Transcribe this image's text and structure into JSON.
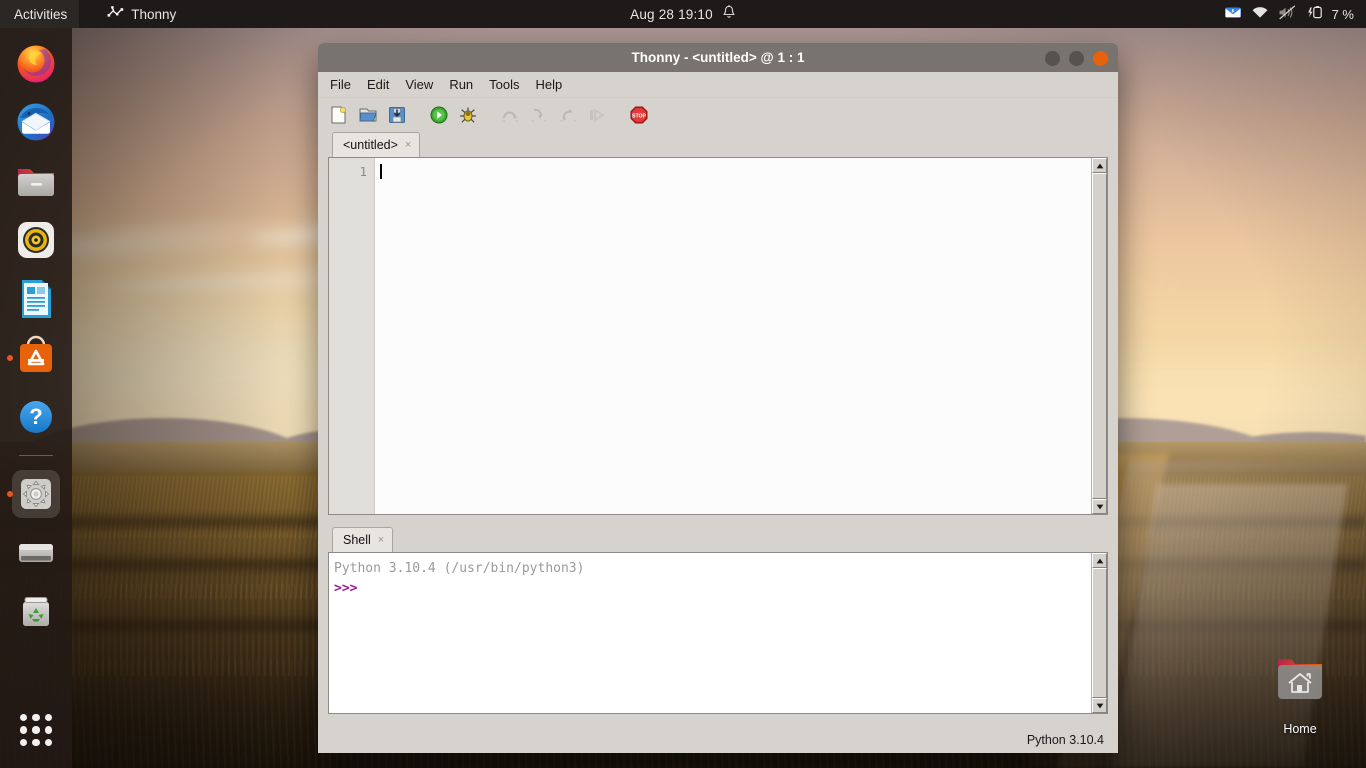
{
  "topbar": {
    "activities": "Activities",
    "app_name": "Thonny",
    "app_icon": "thonny-icon",
    "clock": "Aug 28  19:10",
    "bell_icon": "notification-bell-icon",
    "indicators": [
      {
        "name": "message-indicator-icon"
      },
      {
        "name": "wifi-icon"
      },
      {
        "name": "volume-muted-icon"
      },
      {
        "name": "battery-charging-icon"
      }
    ],
    "battery_percent": "7 %"
  },
  "dock": {
    "items": [
      {
        "name": "dock-item-firefox",
        "label": "Firefox",
        "running": false
      },
      {
        "name": "dock-item-thunderbird",
        "label": "Thunderbird Mail",
        "running": false
      },
      {
        "name": "dock-item-files",
        "label": "Files",
        "running": false
      },
      {
        "name": "dock-item-rhythmbox",
        "label": "Rhythmbox",
        "running": false
      },
      {
        "name": "dock-item-libreoffice-writer",
        "label": "LibreOffice Writer",
        "running": false
      },
      {
        "name": "dock-item-ubuntu-software",
        "label": "Ubuntu Software",
        "running": true
      },
      {
        "name": "dock-item-help",
        "label": "Help",
        "running": false
      },
      {
        "name": "dock-item-thonny",
        "label": "Thonny",
        "running": true
      },
      {
        "name": "dock-item-disk",
        "label": "Disk",
        "running": false
      },
      {
        "name": "dock-item-trash",
        "label": "Trash",
        "running": false
      }
    ],
    "show_apps_label": "Show Applications"
  },
  "desktop": {
    "icons": [
      {
        "name": "desktop-icon-home",
        "label": "Home"
      }
    ]
  },
  "window": {
    "title": "Thonny  -  <untitled>  @  1 : 1",
    "controls": {
      "minimize": "minimize-button",
      "maximize": "maximize-button",
      "close": "close-button"
    },
    "menu": [
      {
        "label": "File"
      },
      {
        "label": "Edit"
      },
      {
        "label": "View"
      },
      {
        "label": "Run"
      },
      {
        "label": "Tools"
      },
      {
        "label": "Help"
      }
    ],
    "toolbar": [
      {
        "name": "new-file-button",
        "icon": "new-document-icon",
        "enabled": true
      },
      {
        "name": "open-file-button",
        "icon": "open-folder-icon",
        "enabled": true
      },
      {
        "name": "save-file-button",
        "icon": "save-disk-icon",
        "enabled": true
      },
      {
        "name": "run-button",
        "icon": "run-play-icon",
        "enabled": true
      },
      {
        "name": "debug-button",
        "icon": "debug-bug-icon",
        "enabled": true
      },
      {
        "name": "step-over-button",
        "icon": "step-over-icon",
        "enabled": false
      },
      {
        "name": "step-into-button",
        "icon": "step-into-icon",
        "enabled": false
      },
      {
        "name": "step-out-button",
        "icon": "step-out-icon",
        "enabled": false
      },
      {
        "name": "resume-button",
        "icon": "resume-icon",
        "enabled": false
      },
      {
        "name": "stop-button",
        "icon": "stop-sign-icon",
        "enabled": true
      }
    ],
    "editor": {
      "tab_label": "<untitled>",
      "tab_close": "×",
      "line_numbers": [
        "1"
      ],
      "content": ""
    },
    "shell": {
      "tab_label": "Shell",
      "tab_close": "×",
      "banner": "Python 3.10.4 (/usr/bin/python3)",
      "prompt": ">>>"
    },
    "statusbar": {
      "interpreter": "Python 3.10.4"
    }
  },
  "colors": {
    "accent": "#e8620c",
    "titlebar": "#78736f",
    "chrome": "#d6d2cd",
    "prompt": "#9b1a91",
    "topbar": "#1d1a19"
  }
}
